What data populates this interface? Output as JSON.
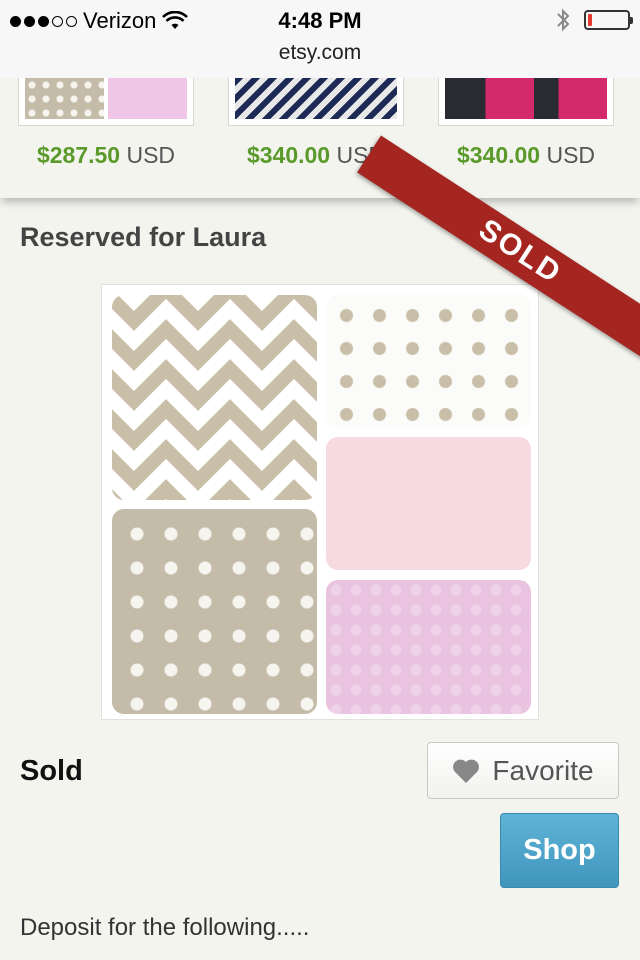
{
  "status_bar": {
    "carrier": "Verizon",
    "signal_bars": 3,
    "signal_total": 5,
    "time": "4:48 PM",
    "battery_level": 0.1,
    "battery_color": "#e23a2e"
  },
  "browser": {
    "url": "etsy.com"
  },
  "related_listings": [
    {
      "price": "$287.50",
      "currency": "USD"
    },
    {
      "price": "$340.00",
      "currency": "USD"
    },
    {
      "price": "$340.00",
      "currency": "USD"
    }
  ],
  "listing": {
    "title": "Reserved for Laura",
    "ribbon": "SOLD",
    "status": "Sold",
    "favorite_label": "Favorite",
    "shop_label": "Shop",
    "description": "Deposit for the following....."
  },
  "colors": {
    "price_green": "#5a9a2a",
    "ribbon_red": "#a52621",
    "shop_blue": "#4aa5cb",
    "taupe": "#c4bca8",
    "pink": "#f7d9e2",
    "lavender_pink": "#e9c3e0"
  },
  "icons": {
    "wifi": "wifi-icon",
    "bluetooth": "bluetooth-icon",
    "battery": "battery-icon",
    "heart": "heart-icon"
  }
}
